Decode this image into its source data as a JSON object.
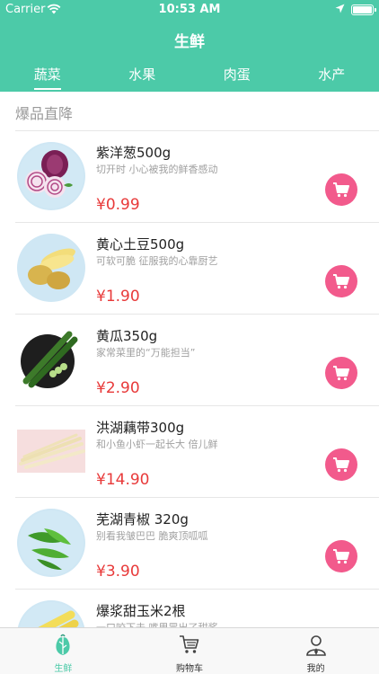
{
  "status_bar": {
    "carrier": "Carrier",
    "time": "10:53 AM"
  },
  "header": {
    "title": "生鲜"
  },
  "tabs": [
    {
      "label": "蔬菜",
      "active": true
    },
    {
      "label": "水果",
      "active": false
    },
    {
      "label": "肉蛋",
      "active": false
    },
    {
      "label": "水产",
      "active": false
    }
  ],
  "section": {
    "title": "爆品直降"
  },
  "products": [
    {
      "name": "紫洋葱500g",
      "desc": "切开时 小心被我的鲜香感动",
      "price": "¥0.99"
    },
    {
      "name": "黄心土豆500g",
      "desc": "可软可脆 征服我的心靠厨艺",
      "price": "¥1.90"
    },
    {
      "name": "黄瓜350g",
      "desc": "家常菜里的“万能担当”",
      "price": "¥2.90"
    },
    {
      "name": "洪湖藕带300g",
      "desc": "和小鱼小虾一起长大 倍儿鲜",
      "price": "¥14.90"
    },
    {
      "name": "芜湖青椒 320g",
      "desc": "别看我皱巴巴 脆爽顶呱呱",
      "price": "¥3.90"
    },
    {
      "name": "爆浆甜玉米2根",
      "desc": "一口咬下去 嘴里冒出了甜浆",
      "price": ""
    }
  ],
  "bottom_nav": [
    {
      "label": "生鲜",
      "icon": "produce-icon",
      "active": true
    },
    {
      "label": "购物车",
      "icon": "cart-icon",
      "active": false
    },
    {
      "label": "我的",
      "icon": "user-icon",
      "active": false
    }
  ],
  "colors": {
    "brand": "#4ccaa8",
    "price": "#e83a3a",
    "cart_button": "#f25a8c"
  }
}
